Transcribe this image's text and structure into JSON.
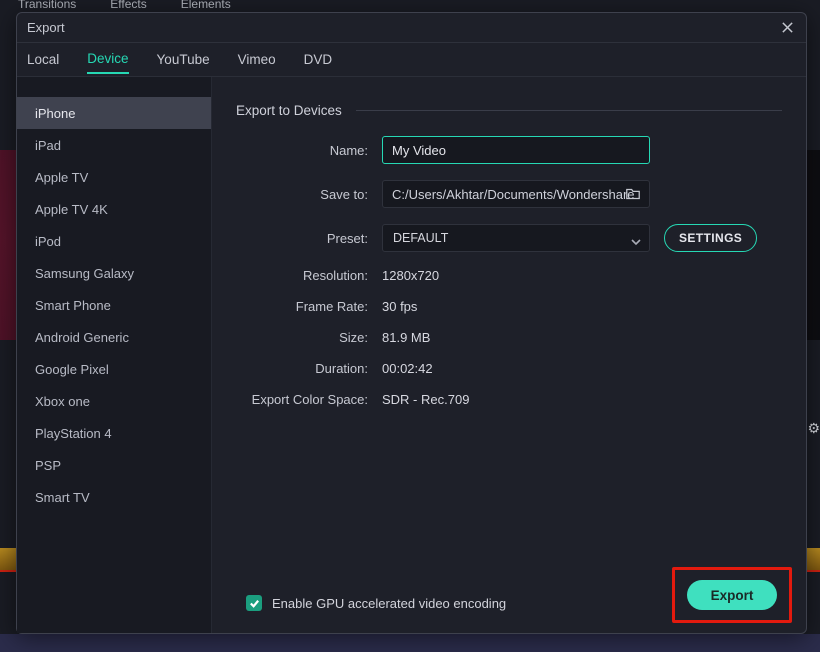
{
  "backdrop_menu": [
    "Transitions",
    "Effects",
    "Elements"
  ],
  "window": {
    "title": "Export"
  },
  "tabs": [
    {
      "label": "Local",
      "active": false
    },
    {
      "label": "Device",
      "active": true
    },
    {
      "label": "YouTube",
      "active": false
    },
    {
      "label": "Vimeo",
      "active": false
    },
    {
      "label": "DVD",
      "active": false
    }
  ],
  "devices": [
    "iPhone",
    "iPad",
    "Apple TV",
    "Apple TV 4K",
    "iPod",
    "Samsung Galaxy",
    "Smart Phone",
    "Android Generic",
    "Google Pixel",
    "Xbox one",
    "PlayStation 4",
    "PSP",
    "Smart TV"
  ],
  "devices_selected": 0,
  "section_title": "Export to Devices",
  "form": {
    "name_label": "Name:",
    "name_value": "My Video",
    "saveto_label": "Save to:",
    "saveto_value": "C:/Users/Akhtar/Documents/Wondershare",
    "preset_label": "Preset:",
    "preset_value": "DEFAULT",
    "settings_btn": "SETTINGS",
    "resolution_label": "Resolution:",
    "resolution_value": "1280x720",
    "framerate_label": "Frame Rate:",
    "framerate_value": "30 fps",
    "size_label": "Size:",
    "size_value": "81.9 MB",
    "duration_label": "Duration:",
    "duration_value": "00:02:42",
    "colorspace_label": "Export Color Space:",
    "colorspace_value": "SDR - Rec.709"
  },
  "gpu_checkbox": {
    "checked": true,
    "label": "Enable GPU accelerated video encoding"
  },
  "export_btn": "Export"
}
